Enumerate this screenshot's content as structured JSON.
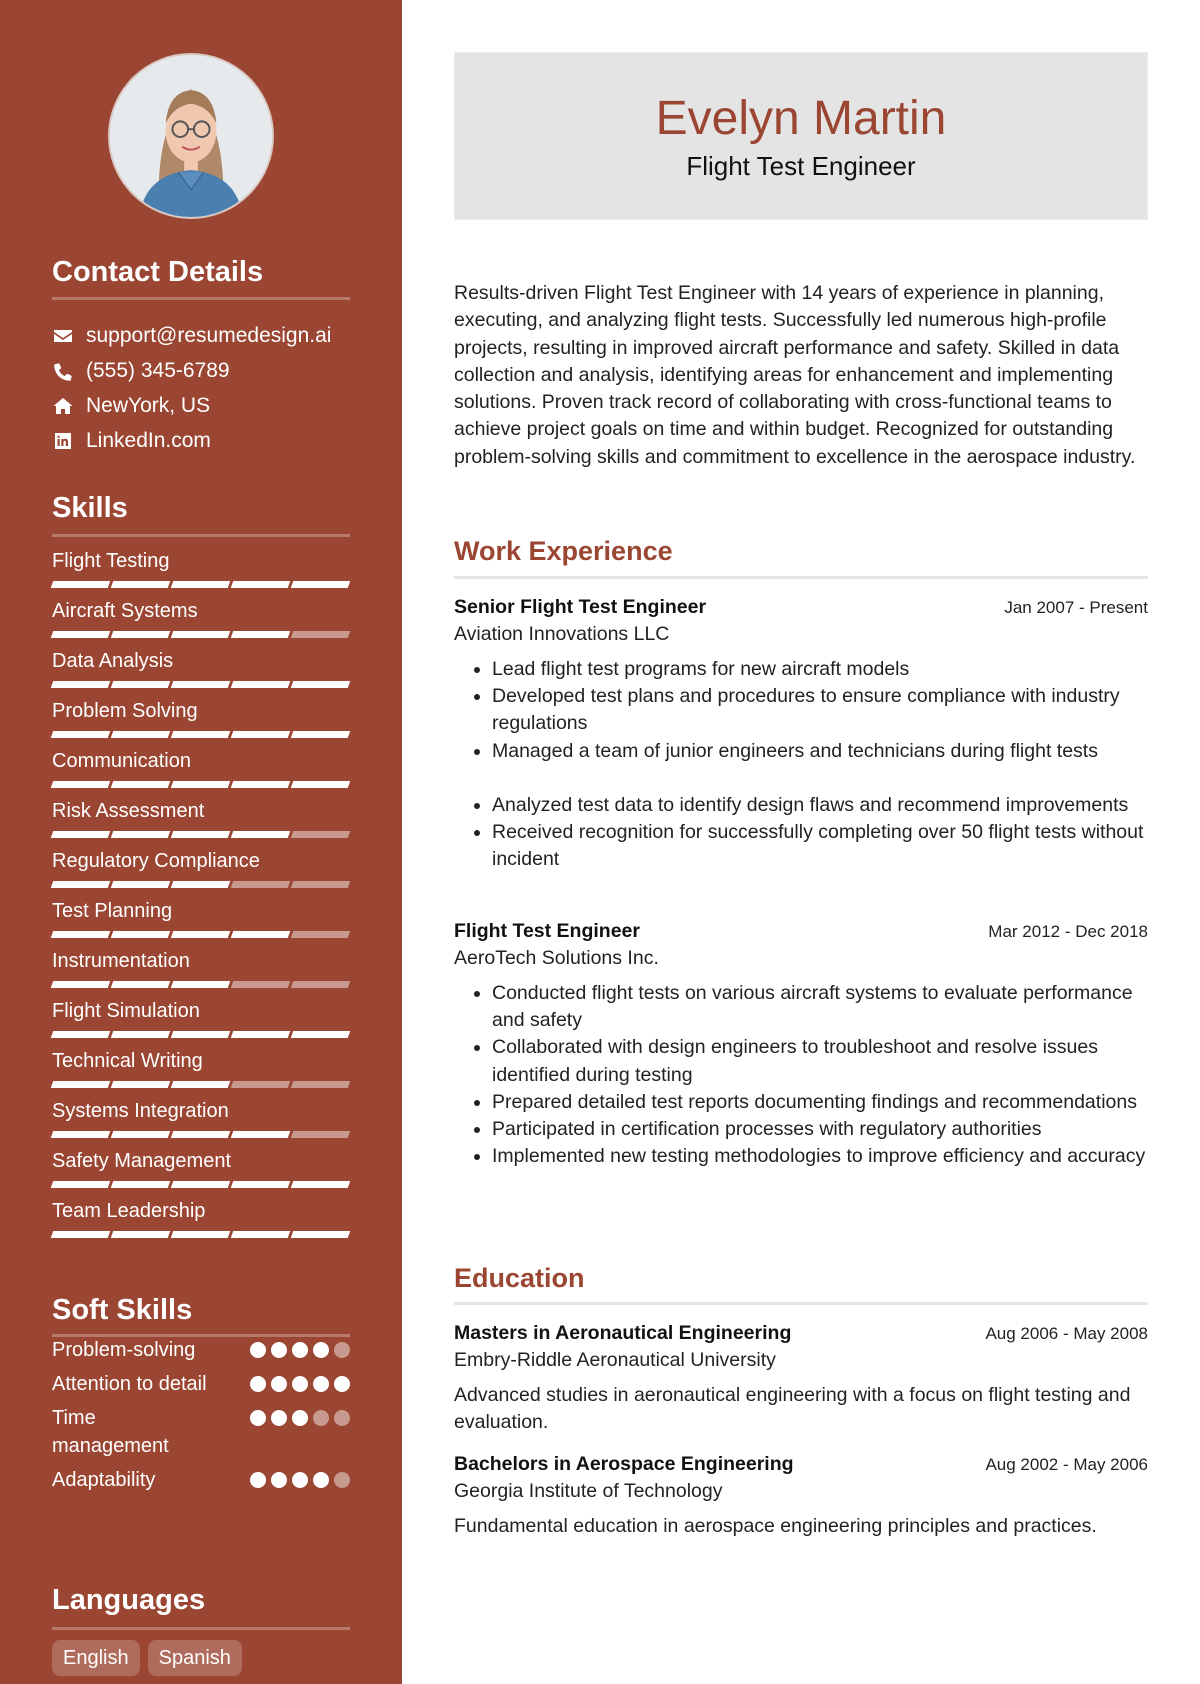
{
  "profile": {
    "name": "Evelyn Martin",
    "title": "Flight Test Engineer",
    "photo_alt": "Profile photo of Evelyn Martin"
  },
  "colors": {
    "accent": "#9b4632",
    "header_bg": "#e4e4e4",
    "sidebar_bg": "#9b4632"
  },
  "sidebar": {
    "contact": {
      "heading": "Contact Details",
      "items": [
        {
          "icon": "envelope-icon",
          "text": "support@resumedesign.ai"
        },
        {
          "icon": "phone-icon",
          "text": "(555) 345-6789"
        },
        {
          "icon": "home-icon",
          "text": "NewYork, US"
        },
        {
          "icon": "linkedin-icon",
          "text": "LinkedIn.com"
        }
      ]
    },
    "skills": {
      "heading": "Skills",
      "max_level": 5,
      "items": [
        {
          "name": "Flight Testing",
          "level": 5
        },
        {
          "name": "Aircraft Systems",
          "level": 4
        },
        {
          "name": "Data Analysis",
          "level": 5
        },
        {
          "name": "Problem Solving",
          "level": 5
        },
        {
          "name": "Communication",
          "level": 5
        },
        {
          "name": "Risk Assessment",
          "level": 4
        },
        {
          "name": "Regulatory Compliance",
          "level": 3
        },
        {
          "name": "Test Planning",
          "level": 4
        },
        {
          "name": "Instrumentation",
          "level": 3
        },
        {
          "name": "Flight Simulation",
          "level": 5
        },
        {
          "name": "Technical Writing",
          "level": 3
        },
        {
          "name": "Systems Integration",
          "level": 4
        },
        {
          "name": "Safety Management",
          "level": 5
        },
        {
          "name": "Team Leadership",
          "level": 5
        }
      ]
    },
    "soft_skills": {
      "heading": "Soft Skills",
      "max_level": 5,
      "items": [
        {
          "name": "Problem-solving",
          "level": 4
        },
        {
          "name": "Attention to detail",
          "level": 5
        },
        {
          "name": "Time management",
          "level": 3
        },
        {
          "name": "Adaptability",
          "level": 4
        }
      ]
    },
    "languages": {
      "heading": "Languages",
      "items": [
        "English",
        "Spanish"
      ]
    }
  },
  "main": {
    "summary": "Results-driven Flight Test Engineer with 14 years of experience in planning, executing, and analyzing flight tests. Successfully led numerous high-profile projects, resulting in improved aircraft performance and safety. Skilled in data collection and analysis, identifying areas for enhancement and implementing solutions. Proven track record of collaborating with cross-functional teams to achieve project goals on time and within budget. Recognized for outstanding problem-solving skills and commitment to excellence in the aerospace industry.",
    "work": {
      "heading": "Work Experience",
      "jobs": [
        {
          "title": "Senior Flight Test Engineer",
          "company": "Aviation Innovations LLC",
          "dates": "Jan 2007 - Present",
          "bullets": [
            "Lead flight test programs for new aircraft models",
            "Developed test plans and procedures to ensure compliance with industry regulations",
            "Managed a team of junior engineers and technicians during flight tests",
            "",
            "Analyzed test data to identify design flaws and recommend improvements",
            "Received recognition for successfully completing over 50 flight tests without incident"
          ]
        },
        {
          "title": "Flight Test Engineer",
          "company": "AeroTech Solutions Inc.",
          "dates": "Mar 2012 - Dec 2018",
          "bullets": [
            "Conducted flight tests on various aircraft systems to evaluate performance and safety",
            "Collaborated with design engineers to troubleshoot and resolve issues identified during testing",
            "Prepared detailed test reports documenting findings and recommendations",
            "Participated in certification processes with regulatory authorities",
            "Implemented new testing methodologies to improve efficiency and accuracy"
          ]
        }
      ]
    },
    "education": {
      "heading": "Education",
      "items": [
        {
          "degree": "Masters in Aeronautical Engineering",
          "school": "Embry-Riddle Aeronautical University",
          "dates": "Aug 2006 - May 2008",
          "description": "Advanced studies in aeronautical engineering with a focus on flight testing and evaluation."
        },
        {
          "degree": "Bachelors in Aerospace Engineering",
          "school": "Georgia Institute of Technology",
          "dates": "Aug 2002 - May 2006",
          "description": "Fundamental education in aerospace engineering principles and practices."
        }
      ]
    }
  }
}
